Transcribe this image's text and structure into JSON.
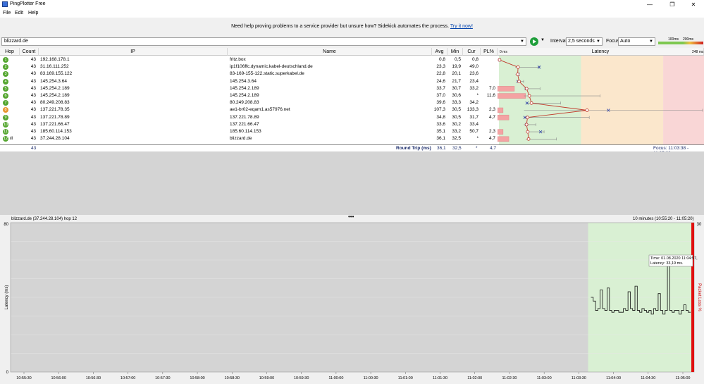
{
  "window": {
    "title": "PingPlotter Free",
    "controls": [
      "—",
      "❐",
      "✕"
    ]
  },
  "menu": [
    "File",
    "Edit",
    "Help"
  ],
  "banner": {
    "text": "Need help proving problems to a service provider but unsure how? Sidekick automates the process.",
    "link": "Try it now!"
  },
  "toolbar": {
    "target": "blizzard.de",
    "interval_label": "Interval",
    "interval_value": "2,5 seconds",
    "focus_label": "Focus",
    "focus_value": "Auto",
    "scale_low": "100ms",
    "scale_high": "200ms"
  },
  "colors": {
    "green_zone": "#d9f0d3",
    "yellow_zone": "#fbe7cc",
    "red_zone": "#f9d6d6",
    "trace_line": "#c0392b",
    "loss_bar": "#f4a3a3",
    "hop_green": "#55a630",
    "hop_orange": "#e8962f",
    "gray_area": "#d4d4d4",
    "loss_red": "#e01010"
  },
  "table": {
    "headers": [
      "Hop",
      "Count",
      "IP",
      "Name",
      "Avg",
      "Min",
      "Cur",
      "PL%",
      "Latency"
    ],
    "latency_axis_left": "0 ms",
    "latency_axis_right": "248 ms",
    "rows": [
      {
        "hop": "1",
        "count": "43",
        "ip": "192.168.178.1",
        "name": "fritz.box",
        "avg": "0,8",
        "min": "0,5",
        "cur": "0,8",
        "pl": "",
        "color": "green"
      },
      {
        "hop": "2",
        "count": "43",
        "ip": "31.16.111.252",
        "name": "ip1f106ffc.dynamic.kabel-deutschland.de",
        "avg": "23,3",
        "min": "19,9",
        "cur": "49,0",
        "pl": "",
        "color": "green"
      },
      {
        "hop": "3",
        "count": "43",
        "ip": "83.169.155.122",
        "name": "83-169-155-122.static.superkabel.de",
        "avg": "22,8",
        "min": "20,1",
        "cur": "23,6",
        "pl": "",
        "color": "green"
      },
      {
        "hop": "4",
        "count": "43",
        "ip": "145.254.3.64",
        "name": "145.254.3.64",
        "avg": "24,6",
        "min": "21,7",
        "cur": "23,4",
        "pl": "",
        "color": "green"
      },
      {
        "hop": "5",
        "count": "43",
        "ip": "145.254.2.189",
        "name": "145.254.2.189",
        "avg": "33,7",
        "min": "30,7",
        "cur": "33,2",
        "pl": "7,0",
        "color": "green"
      },
      {
        "hop": "6",
        "count": "43",
        "ip": "145.254.2.189",
        "name": "145.254.2.189",
        "avg": "37,0",
        "min": "30,6",
        "cur": "*",
        "pl": "11,6",
        "color": "green"
      },
      {
        "hop": "7",
        "count": "43",
        "ip": "80.249.208.83",
        "name": "80.249.208.83",
        "avg": "39,6",
        "min": "33,3",
        "cur": "34,2",
        "pl": "",
        "color": "green"
      },
      {
        "hop": "8",
        "count": "43",
        "ip": "137.221.78.35",
        "name": "ae1-br02-eqam1.as57976.net",
        "avg": "107,3",
        "min": "30,5",
        "cur": "133,3",
        "pl": "2,3",
        "color": "orange"
      },
      {
        "hop": "9",
        "count": "43",
        "ip": "137.221.78.89",
        "name": "137.221.78.89",
        "avg": "34,8",
        "min": "30,5",
        "cur": "31,7",
        "pl": "4,7",
        "color": "green"
      },
      {
        "hop": "10",
        "count": "43",
        "ip": "137.221.66.47",
        "name": "137.221.66.47",
        "avg": "33,6",
        "min": "30,2",
        "cur": "33,4",
        "pl": "",
        "color": "green"
      },
      {
        "hop": "11",
        "count": "43",
        "ip": "185.60.114.153",
        "name": "185.60.114.153",
        "avg": "35,1",
        "min": "33,2",
        "cur": "50,7",
        "pl": "2,3",
        "color": "green"
      },
      {
        "hop": "12",
        "count": "43",
        "ip": "37.244.28.104",
        "name": "blizzard.de",
        "avg": "36,1",
        "min": "32,5",
        "cur": "*",
        "pl": "4,7",
        "color": "green"
      }
    ],
    "latency_markers": [
      {
        "avg": 0.8,
        "min": 0.5,
        "max": 1.0,
        "cur": 0.8
      },
      {
        "avg": 23.3,
        "min": 19.9,
        "max": 49.0,
        "cur": 49.0
      },
      {
        "avg": 22.8,
        "min": 20.1,
        "max": 24.0,
        "cur": 23.6
      },
      {
        "avg": 24.6,
        "min": 21.7,
        "max": 30.0,
        "cur": 23.4
      },
      {
        "avg": 33.7,
        "min": 30.7,
        "max": 50.0,
        "cur": 33.2
      },
      {
        "avg": 37.0,
        "min": 30.6,
        "max": 123.0,
        "cur": null
      },
      {
        "avg": 39.6,
        "min": 33.3,
        "max": 75.0,
        "cur": 34.2
      },
      {
        "avg": 107.3,
        "min": 30.5,
        "max": 248.0,
        "cur": 133.3
      },
      {
        "avg": 34.8,
        "min": 30.5,
        "max": 110.0,
        "cur": 31.7
      },
      {
        "avg": 33.6,
        "min": 30.2,
        "max": 45.0,
        "cur": 33.4
      },
      {
        "avg": 35.1,
        "min": 33.2,
        "max": 55.0,
        "cur": 50.7
      },
      {
        "avg": 36.1,
        "min": 32.5,
        "max": 70.0,
        "cur": null
      }
    ],
    "footer": {
      "count": "43",
      "label": "Round Trip (ms)",
      "avg": "36,1",
      "min": "32,5",
      "cur": "*",
      "pl": "4,7",
      "focus": "Focus: 11:03:38 - 11:05:20"
    }
  },
  "graph": {
    "title": "blizzard.de (37.244.28.104) hop 12",
    "range": "10 minutes (10:55:20 - 11:05:20)",
    "y_label": "Latency (ms)",
    "y_right_label": "Packet Loss %",
    "y_max_label": "80",
    "y_min_label": "0",
    "y_right_max": "30",
    "tooltip_time": "Time: 01.08.2020 11:04:57,",
    "tooltip_latency": "Latency: 33,19 ms.",
    "x_ticks": [
      "10:55:30",
      "10:56:00",
      "10:56:30",
      "10:57:00",
      "10:57:30",
      "10:58:00",
      "10:58:30",
      "10:59:00",
      "10:59:30",
      "11:00:00",
      "11:00:30",
      "11:01:00",
      "11:01:30",
      "11:02:00",
      "11:02:30",
      "11:03:00",
      "11:03:30",
      "11:04:00",
      "11:04:30",
      "11:05:00"
    ],
    "focus_start": "11:03:38",
    "series_latency": [
      40,
      38,
      33,
      34,
      44,
      34,
      33,
      45,
      33,
      32,
      33,
      33,
      32,
      32,
      34,
      33,
      43,
      34,
      33,
      46,
      33,
      32,
      34,
      33,
      32,
      33,
      31,
      34,
      33,
      42,
      33,
      31,
      33,
      60,
      33,
      32,
      33,
      33,
      31,
      33,
      36,
      33,
      32
    ]
  }
}
